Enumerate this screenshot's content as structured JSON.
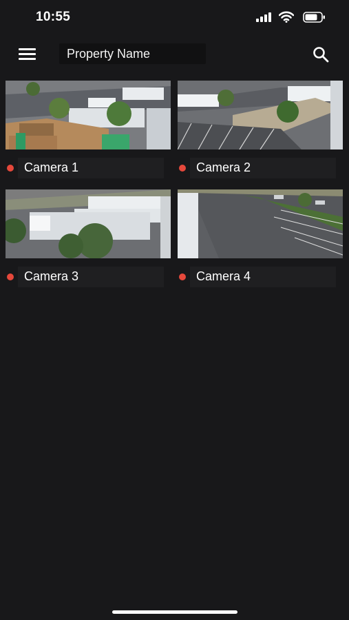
{
  "status_bar": {
    "time": "10:55",
    "icons": [
      "cellular-signal-icon",
      "wifi-icon",
      "battery-icon"
    ]
  },
  "app_bar": {
    "title": "Property Name",
    "menu_icon": "hamburger-menu-icon",
    "search_icon": "search-icon"
  },
  "cameras": [
    {
      "name": "Camera 1",
      "status_color": "#e5483b"
    },
    {
      "name": "Camera 2",
      "status_color": "#e5483b"
    },
    {
      "name": "Camera 3",
      "status_color": "#e5483b"
    },
    {
      "name": "Camera 4",
      "status_color": "#e5483b"
    }
  ],
  "colors": {
    "background": "#18181a",
    "status_dot": "#e5483b",
    "title_field": "#111112"
  }
}
